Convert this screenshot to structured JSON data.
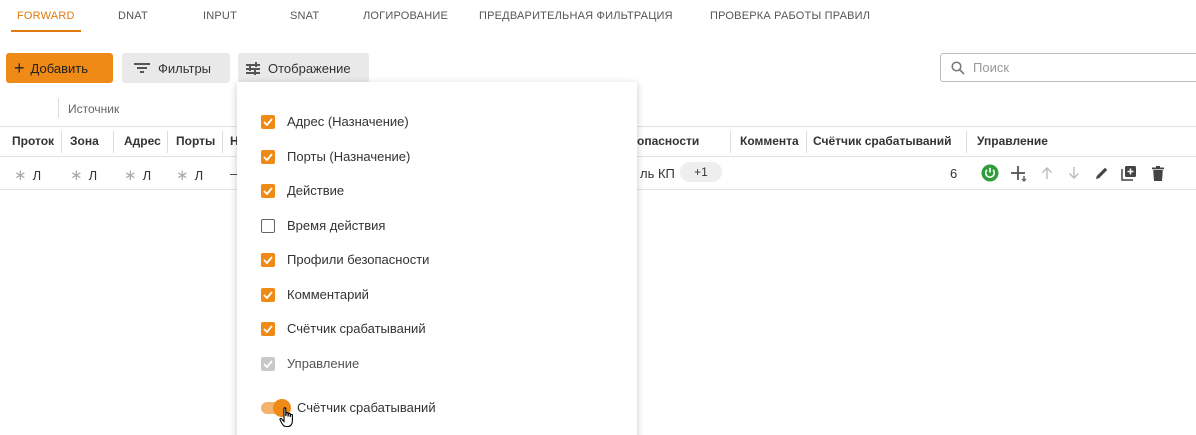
{
  "tabs": [
    {
      "label": "FORWARD",
      "active": true
    },
    {
      "label": "DNAT"
    },
    {
      "label": "INPUT"
    },
    {
      "label": "SNAT"
    },
    {
      "label": "ЛОГИРОВАНИЕ"
    },
    {
      "label": "ПРЕДВАРИТЕЛЬНАЯ ФИЛЬТРАЦИЯ"
    },
    {
      "label": "ПРОВЕРКА РАБОТЫ ПРАВИЛ"
    }
  ],
  "toolbar": {
    "add_label": "Добавить",
    "filters_label": "Фильтры",
    "display_label": "Отображение",
    "search_placeholder": "Поиск"
  },
  "table": {
    "group_label": "Источник",
    "columns": {
      "protocol": "Проток",
      "zone": "Зона",
      "address": "Адрес",
      "ports": "Порты",
      "n": "Н",
      "security": "опасности",
      "comment": "Коммента",
      "counter": "Счётчик срабатываний",
      "management": "Управление"
    },
    "row": {
      "protocol": "Л",
      "zone": "Л",
      "address": "Л",
      "ports": "Л",
      "n": "–",
      "security": "ль КП",
      "security_more": "+1",
      "counter": "6"
    }
  },
  "display_menu": {
    "options": [
      {
        "label": "Адрес (Назначение)",
        "state": "checked"
      },
      {
        "label": "Порты (Назначение)",
        "state": "checked"
      },
      {
        "label": "Действие",
        "state": "checked"
      },
      {
        "label": "Время действия",
        "state": "unchecked"
      },
      {
        "label": "Профили безопасности",
        "state": "checked"
      },
      {
        "label": "Комментарий",
        "state": "checked"
      },
      {
        "label": "Счётчик срабатываний",
        "state": "checked"
      },
      {
        "label": "Управление",
        "state": "disabled-checked"
      }
    ],
    "toggle_label": "Счётчик срабатываний",
    "toggle_on": true
  },
  "colors": {
    "accent": "#ef8a17",
    "power_icon": "#2e9d3a"
  },
  "icons": [
    "plus-icon",
    "filter-lines-icon",
    "tune-icon",
    "search-icon",
    "asterisk-icon",
    "power-icon",
    "insert-row-icon",
    "arrow-up-icon",
    "arrow-down-icon",
    "edit-pencil-icon",
    "duplicate-icon",
    "trash-icon",
    "check-icon",
    "hand-cursor-icon"
  ]
}
